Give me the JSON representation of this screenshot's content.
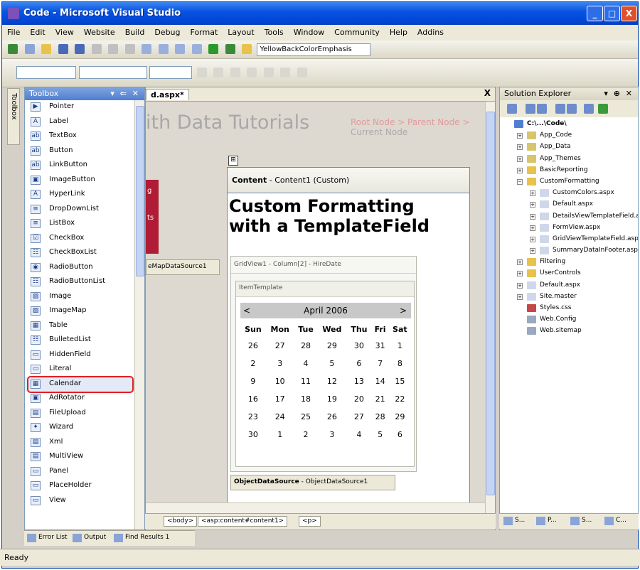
{
  "window": {
    "title": "Code - Microsoft Visual Studio",
    "min": "_",
    "max": "□",
    "close": "X"
  },
  "menu": [
    "File",
    "Edit",
    "View",
    "Website",
    "Build",
    "Debug",
    "Format",
    "Layout",
    "Tools",
    "Window",
    "Community",
    "Help",
    "Addins"
  ],
  "toolbar": {
    "combo_value": "YellowBackColorEmphasis"
  },
  "toolbox": {
    "title": "Toolbox",
    "side_tab_label": "Toolbox",
    "items": [
      "Pointer",
      "Label",
      "TextBox",
      "Button",
      "LinkButton",
      "ImageButton",
      "HyperLink",
      "DropDownList",
      "ListBox",
      "CheckBox",
      "CheckBoxList",
      "RadioButton",
      "RadioButtonList",
      "Image",
      "ImageMap",
      "Table",
      "BulletedList",
      "HiddenField",
      "Literal",
      "Calendar",
      "AdRotator",
      "FileUpload",
      "Wizard",
      "Xml",
      "MultiView",
      "Panel",
      "PlaceHolder",
      "View"
    ],
    "icons": [
      "▶",
      "A",
      "ab",
      "ab",
      "ab",
      "▣",
      "A",
      "≡",
      "≡",
      "☑",
      "☷",
      "◉",
      "☷",
      "▨",
      "▨",
      "▦",
      "☷",
      "▭",
      "▭",
      "▦",
      "▣",
      "▤",
      "✦",
      "▤",
      "▤",
      "▭",
      "▭",
      "▭"
    ],
    "highlighted": "Calendar"
  },
  "editor": {
    "tab": "d.aspx*",
    "close": "X",
    "site_title": "ith Data Tutorials",
    "breadcrumb": {
      "root": "Root Node",
      "sep1": " > ",
      "parent": "Parent Node",
      "sep2": " > ",
      "current": "Current Node"
    },
    "red_menu": [
      "g",
      "ts"
    ],
    "sitemap_source": "eMapDataSource1",
    "content_header_bold": "Content",
    "content_header_rest": " - Content1 (Custom)",
    "handle": "⊞",
    "heading": "Custom Formatting with a TemplateField",
    "gridview_header": "GridView1 - Column[2] - HireDate",
    "item_template": "ItemTemplate",
    "ods_bold": "ObjectDataSource",
    "ods_rest": " - ObjectDataSource1",
    "tags": [
      "<body>",
      "<asp:content#content1>",
      "<p>"
    ]
  },
  "calendar": {
    "prev": "<",
    "next": ">",
    "month": "April 2006",
    "days": [
      "Sun",
      "Mon",
      "Tue",
      "Wed",
      "Thu",
      "Fri",
      "Sat"
    ],
    "weeks": [
      [
        "26",
        "27",
        "28",
        "29",
        "30",
        "31",
        "1"
      ],
      [
        "2",
        "3",
        "4",
        "5",
        "6",
        "7",
        "8"
      ],
      [
        "9",
        "10",
        "11",
        "12",
        "13",
        "14",
        "15"
      ],
      [
        "16",
        "17",
        "18",
        "19",
        "20",
        "21",
        "22"
      ],
      [
        "23",
        "24",
        "25",
        "26",
        "27",
        "28",
        "29"
      ],
      [
        "30",
        "1",
        "2",
        "3",
        "4",
        "5",
        "6"
      ]
    ]
  },
  "solution_explorer": {
    "title": "Solution Explorer",
    "tree": [
      {
        "label": "C:\\...\\Code\\",
        "level": 0,
        "exp": "",
        "color": "#4e7fd0",
        "bold": true
      },
      {
        "label": "App_Code",
        "level": 1,
        "exp": "+",
        "color": "#d8c46a"
      },
      {
        "label": "App_Data",
        "level": 1,
        "exp": "+",
        "color": "#d8c46a"
      },
      {
        "label": "App_Themes",
        "level": 1,
        "exp": "+",
        "color": "#d8c46a"
      },
      {
        "label": "BasicReporting",
        "level": 1,
        "exp": "+",
        "color": "#e8c24a"
      },
      {
        "label": "CustomFormatting",
        "level": 1,
        "exp": "−",
        "color": "#e8c24a"
      },
      {
        "label": "CustomColors.aspx",
        "level": 2,
        "exp": "+",
        "color": "#cfd8ea"
      },
      {
        "label": "Default.aspx",
        "level": 2,
        "exp": "+",
        "color": "#cfd8ea"
      },
      {
        "label": "DetailsViewTemplateField.aspx",
        "level": 2,
        "exp": "+",
        "color": "#cfd8ea"
      },
      {
        "label": "FormView.aspx",
        "level": 2,
        "exp": "+",
        "color": "#cfd8ea"
      },
      {
        "label": "GridViewTemplateField.aspx",
        "level": 2,
        "exp": "+",
        "color": "#cfd8ea"
      },
      {
        "label": "SummaryDataInFooter.aspx",
        "level": 2,
        "exp": "+",
        "color": "#cfd8ea"
      },
      {
        "label": "Filtering",
        "level": 1,
        "exp": "+",
        "color": "#e8c24a"
      },
      {
        "label": "UserControls",
        "level": 1,
        "exp": "+",
        "color": "#e8c24a"
      },
      {
        "label": "Default.aspx",
        "level": 1,
        "exp": "+",
        "color": "#cfd8ea"
      },
      {
        "label": "Site.master",
        "level": 1,
        "exp": "+",
        "color": "#cfd8ea"
      },
      {
        "label": "Styles.css",
        "level": 1,
        "exp": "",
        "color": "#c44848"
      },
      {
        "label": "Web.Config",
        "level": 1,
        "exp": "",
        "color": "#9aa8c0"
      },
      {
        "label": "Web.sitemap",
        "level": 1,
        "exp": "",
        "color": "#9aa8c0"
      }
    ],
    "bottom": [
      "S...",
      "P...",
      "S...",
      "C..."
    ]
  },
  "bottom_tabs": [
    "Error List",
    "Output",
    "Find Results 1"
  ],
  "status": "Ready"
}
